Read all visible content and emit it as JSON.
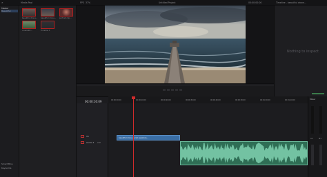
{
  "topbar": {
    "media_pool_label": "Media Pool",
    "fps_label": "FPS",
    "zoom_label": "37%",
    "project_title": "Untitled Project",
    "timeline_name": "Timeline - beautiful drone...",
    "timecode_top": "00:00:00:00"
  },
  "pool": {
    "sidebar_items": [
      "Master",
      "Beautiful"
    ],
    "bottom_items": [
      "Smart Bins",
      "Keywords"
    ],
    "clips": [
      {
        "label": "beautiful drone..."
      },
      {
        "label": "beautiful drone..."
      },
      {
        "label": "portrait clip..."
      },
      {
        "label": "cinematic..."
      },
      {
        "label": "Timeline 1"
      }
    ]
  },
  "inspector": {
    "empty_text": "Nothing to inspect"
  },
  "timeline": {
    "timecode": "00:00:16:09",
    "ruler_marks": [
      "00:00:00:00",
      "00:00:10:00",
      "00:00:20:00",
      "00:00:30:00",
      "00:00:40:00",
      "00:00:50:00",
      "00:01:00:00",
      "00:01:10:00"
    ],
    "video_track": {
      "name": "V1",
      "clip_label": "beautiful drone aerial seashore..."
    },
    "audio_track": {
      "name": "Audio 1",
      "level": "2.0"
    }
  },
  "mixer": {
    "title": "Mixer",
    "channels": [
      "A1",
      "M1"
    ]
  },
  "colors": {
    "playhead": "#d02b2b",
    "video_clip": "#3a6ea5",
    "audio_clip": "#4e9a7a"
  }
}
